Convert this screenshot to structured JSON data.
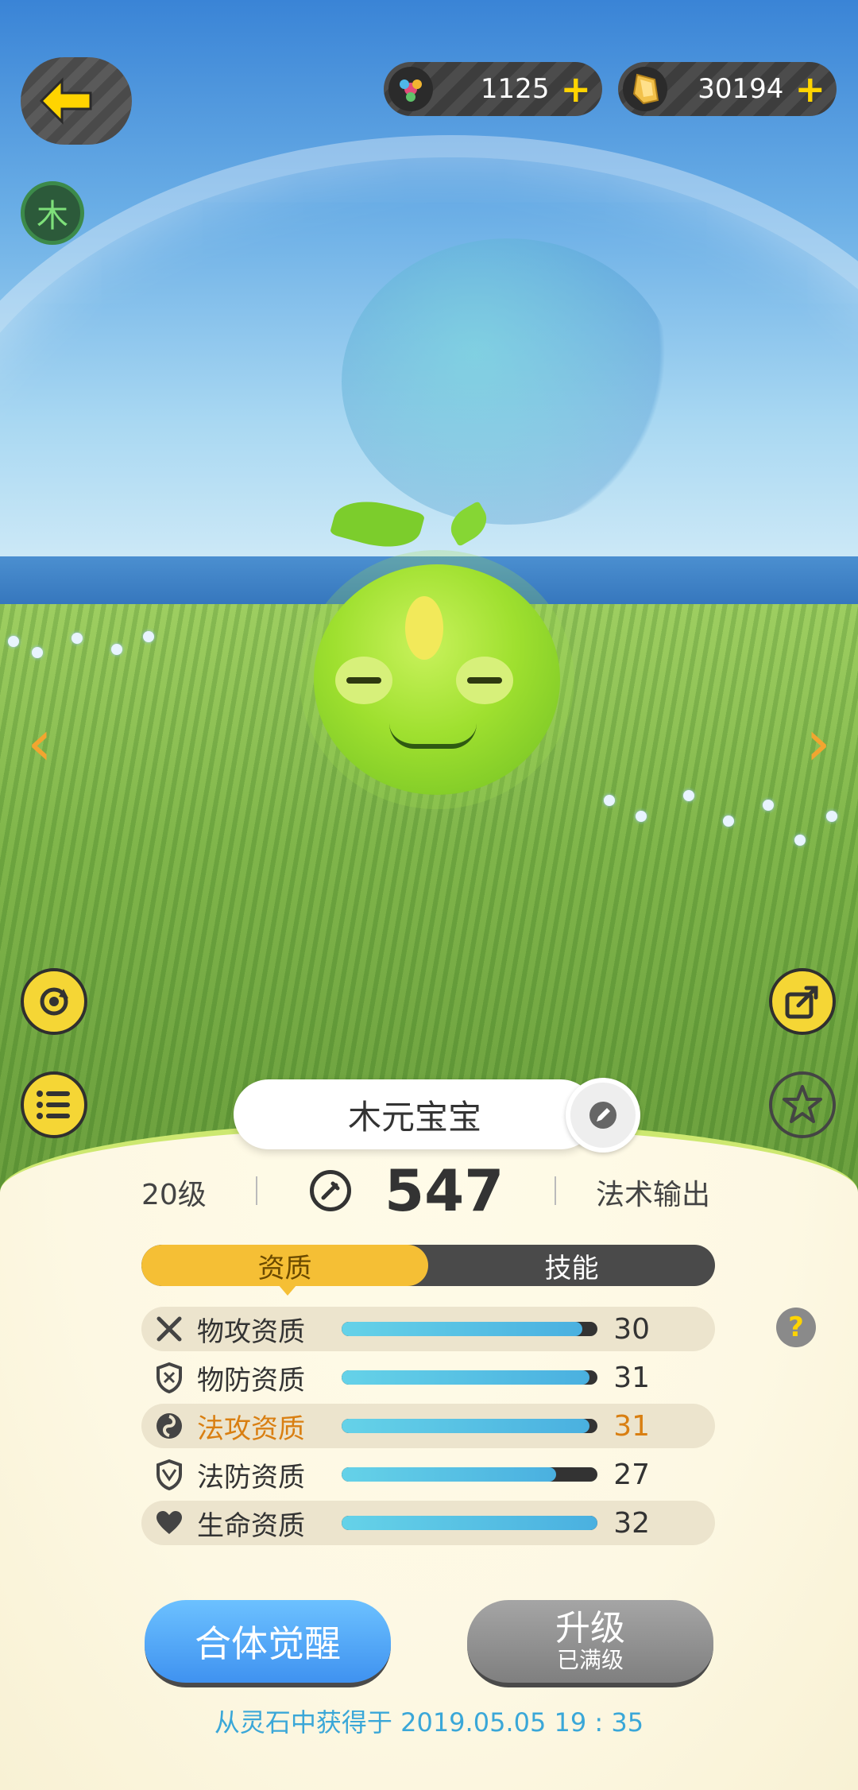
{
  "currencies": [
    {
      "icon": "flower-gem-icon",
      "value": "1125"
    },
    {
      "icon": "gold-crystal-icon",
      "value": "30194"
    }
  ],
  "element_badge": "木",
  "pet": {
    "name": "木元宝宝",
    "level": "20级",
    "power": "547",
    "role": "法术输出"
  },
  "tabs": [
    {
      "label": "资质",
      "active": true
    },
    {
      "label": "技能",
      "active": false
    }
  ],
  "attributes": [
    {
      "label": "物攻资质",
      "value": "30",
      "fill": 0.94,
      "icon": "crossed-swords-icon",
      "highlight": false
    },
    {
      "label": "物防资质",
      "value": "31",
      "fill": 0.97,
      "icon": "shield-icon",
      "highlight": false
    },
    {
      "label": "法攻资质",
      "value": "31",
      "fill": 0.97,
      "icon": "swirl-icon",
      "highlight": true
    },
    {
      "label": "法防资质",
      "value": "27",
      "fill": 0.84,
      "icon": "magic-shield-icon",
      "highlight": false
    },
    {
      "label": "生命资质",
      "value": "32",
      "fill": 1.0,
      "icon": "heart-icon",
      "highlight": false
    }
  ],
  "buttons": {
    "awaken": "合体觉醒",
    "upgrade_main": "升级",
    "upgrade_sub": "已满级"
  },
  "origin_text": "从灵石中获得于 2019.05.05   19 : 35",
  "colors": {
    "accent_yellow": "#f5bf35",
    "bar_fill": "#4ab0e0",
    "highlight_orange": "#d97f12",
    "origin_blue": "#3aa7d8"
  }
}
